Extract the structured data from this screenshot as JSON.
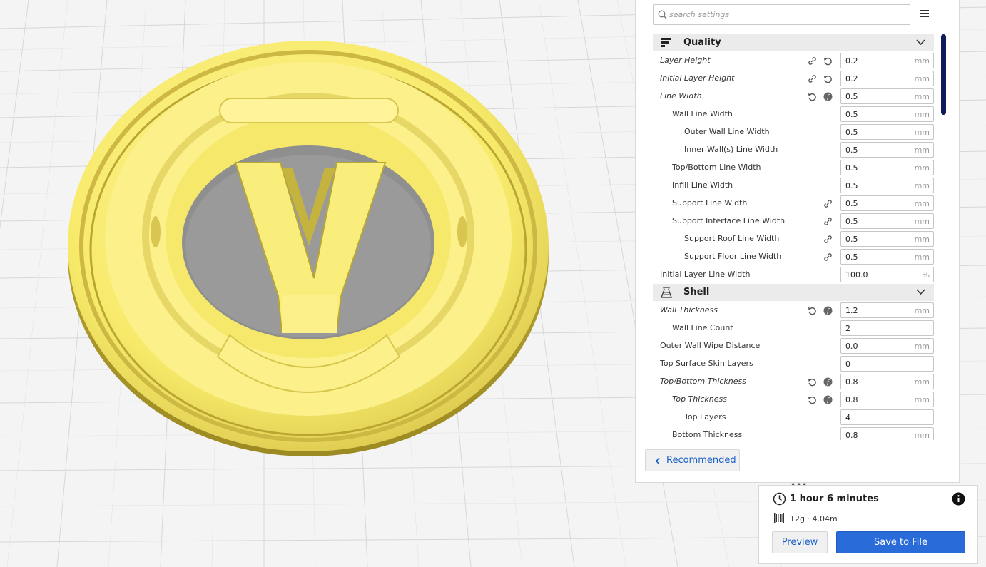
{
  "search": {
    "placeholder": "search settings",
    "value": ""
  },
  "menu": {
    "icon": "hamburger-menu-icon"
  },
  "categories": {
    "quality": {
      "label": "Quality",
      "icon": "quality-icon"
    },
    "shell": {
      "label": "Shell",
      "icon": "shell-icon"
    }
  },
  "settings": [
    {
      "label": "Layer Height",
      "value": "0.2",
      "unit": "mm"
    },
    {
      "label": "Initial Layer Height",
      "value": "0.2",
      "unit": "mm"
    },
    {
      "label": "Line Width",
      "value": "0.5",
      "unit": "mm"
    },
    {
      "label": "Wall Line Width",
      "value": "0.5",
      "unit": "mm"
    },
    {
      "label": "Outer Wall Line Width",
      "value": "0.5",
      "unit": "mm"
    },
    {
      "label": "Inner Wall(s) Line Width",
      "value": "0.5",
      "unit": "mm"
    },
    {
      "label": "Top/Bottom Line Width",
      "value": "0.5",
      "unit": "mm"
    },
    {
      "label": "Infill Line Width",
      "value": "0.5",
      "unit": "mm"
    },
    {
      "label": "Support Line Width",
      "value": "0.5",
      "unit": "mm"
    },
    {
      "label": "Support Interface Line Width",
      "value": "0.5",
      "unit": "mm"
    },
    {
      "label": "Support Roof Line Width",
      "value": "0.5",
      "unit": "mm"
    },
    {
      "label": "Support Floor Line Width",
      "value": "0.5",
      "unit": "mm"
    },
    {
      "label": "Initial Layer Line Width",
      "value": "100.0",
      "unit": "%"
    },
    {
      "label": "Wall Thickness",
      "value": "1.2",
      "unit": "mm"
    },
    {
      "label": "Wall Line Count",
      "value": "2",
      "unit": ""
    },
    {
      "label": "Outer Wall Wipe Distance",
      "value": "0.0",
      "unit": "mm"
    },
    {
      "label": "Top Surface Skin Layers",
      "value": "0",
      "unit": ""
    },
    {
      "label": "Top/Bottom Thickness",
      "value": "0.8",
      "unit": "mm"
    },
    {
      "label": "Top Thickness",
      "value": "0.8",
      "unit": "mm"
    },
    {
      "label": "Top Layers",
      "value": "4",
      "unit": ""
    },
    {
      "label": "Bottom Thickness",
      "value": "0.8",
      "unit": "mm"
    }
  ],
  "recommended": {
    "label": "Recommended"
  },
  "print": {
    "time": "1 hour 6 minutes",
    "material": "12g · 4.04m",
    "preview_label": "Preview",
    "save_label": "Save to File"
  },
  "colors": {
    "accent": "#2a6bda",
    "model": "#f7ec6d",
    "scrollbar": "#0e1c5c"
  }
}
